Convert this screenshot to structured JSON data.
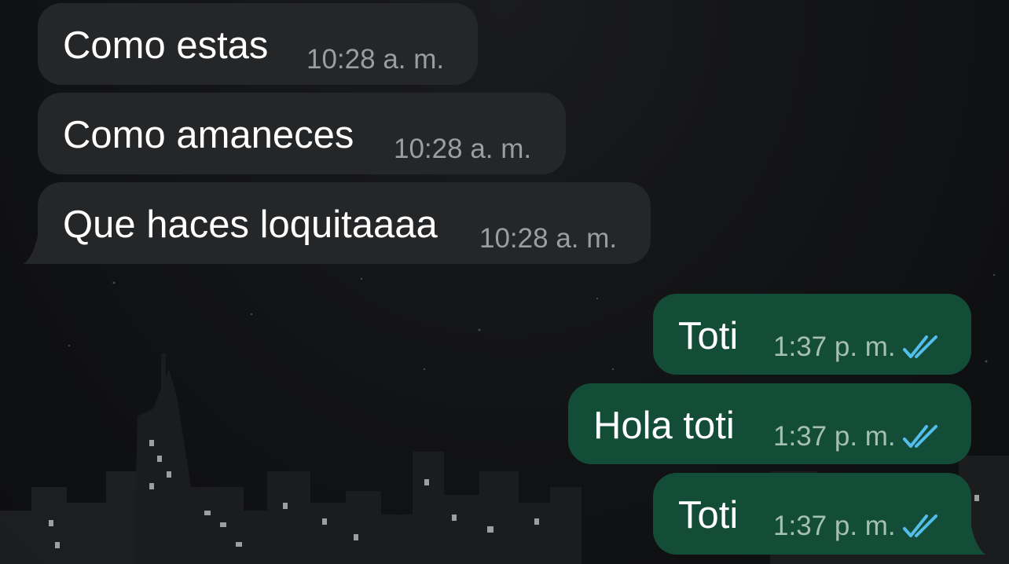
{
  "messages": [
    {
      "text": "Como estas",
      "time": "10:28",
      "ampm": "a. m.",
      "direction": "incoming"
    },
    {
      "text": "Como amaneces",
      "time": "10:28",
      "ampm": "a. m.",
      "direction": "incoming"
    },
    {
      "text": "Que haces loquitaaaa",
      "time": "10:28",
      "ampm": "a. m.",
      "direction": "incoming"
    },
    {
      "text": "Toti",
      "time": "1:37",
      "ampm": "p. m.",
      "direction": "outgoing",
      "status": "read"
    },
    {
      "text": "Hola toti",
      "time": "1:37",
      "ampm": "p. m.",
      "direction": "outgoing",
      "status": "read"
    },
    {
      "text": "Toti",
      "time": "1:37",
      "ampm": "p. m.",
      "direction": "outgoing",
      "status": "read"
    }
  ],
  "colors": {
    "incoming_bubble": "#252628",
    "outgoing_bubble": "#144d37",
    "read_ticks": "#53bdeb",
    "background": "#111214"
  },
  "icons": {
    "read_receipt": "double-check-icon",
    "wallpaper": "night-city-skyline"
  }
}
